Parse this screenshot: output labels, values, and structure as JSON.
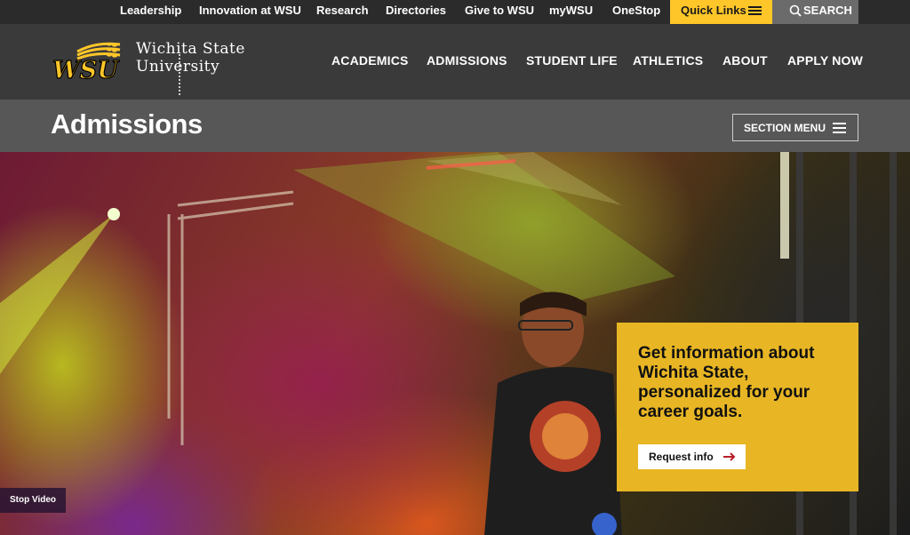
{
  "utility_bar": {
    "links": [
      "Leadership",
      "Innovation at WSU",
      "Research",
      "Directories",
      "Give to WSU",
      "myWSU",
      "OneStop"
    ],
    "quick_links_label": "Quick Links",
    "search_label": "SEARCH"
  },
  "logo": {
    "monogram": "WSU",
    "wordmark_line1": "Wichita State",
    "wordmark_line2": "University"
  },
  "main_nav": [
    "ACADEMICS",
    "ADMISSIONS",
    "STUDENT LIFE",
    "ATHLETICS",
    "ABOUT",
    "APPLY NOW"
  ],
  "section": {
    "title": "Admissions",
    "menu_label": "SECTION MENU"
  },
  "hero": {
    "info_text": "Get information about Wichita State, personalized for your career goals.",
    "request_button": "Request info",
    "stop_video": "Stop Video"
  },
  "colors": {
    "gold": "#ffc629",
    "card_gold": "#e8b624",
    "nav_bg": "#3a3a3a",
    "utility_bg": "#2b2b2b",
    "section_bg": "#575757",
    "arrow_red": "#b8202a"
  }
}
